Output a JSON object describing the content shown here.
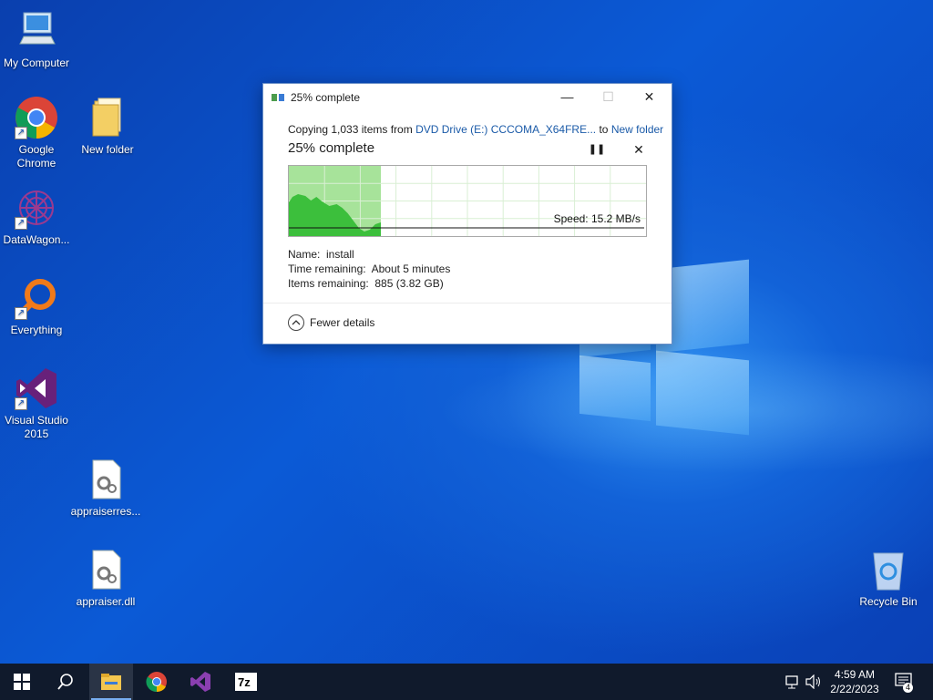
{
  "desktop": {
    "icons": [
      {
        "label": "My Computer",
        "icon": "computer-icon"
      },
      {
        "label": "Google Chrome",
        "icon": "chrome-icon"
      },
      {
        "label": "New folder",
        "icon": "folder-icon"
      },
      {
        "label": "DataWagon...",
        "icon": "datawagon-icon"
      },
      {
        "label": "Everything",
        "icon": "everything-icon"
      },
      {
        "label": "Visual Studio 2015",
        "icon": "visual-studio-icon"
      },
      {
        "label": "appraiserres...",
        "icon": "config-file-icon"
      },
      {
        "label": "appraiser.dll",
        "icon": "dll-file-icon"
      },
      {
        "label": "Recycle Bin",
        "icon": "recycle-bin-icon"
      }
    ]
  },
  "dialog": {
    "title": "25% complete",
    "copy_prefix": "Copying 1,033 items from",
    "source": "DVD Drive (E:) CCCOMA_X64FRE...",
    "to_word": "to",
    "destination": "New folder",
    "progress_text": "25% complete",
    "progress_fraction": 0.25,
    "speed": "Speed: 15.2 MB/s",
    "name_label": "Name:",
    "name_value": "install",
    "time_label": "Time remaining:",
    "time_value": "About 5 minutes",
    "items_label": "Items remaining:",
    "items_value": "885 (3.82 GB)",
    "details_toggle": "Fewer details",
    "colors": {
      "graph_fill": "#3cbf3c",
      "graph_done_bg": "#a7e39a",
      "grid": "#d9efd4"
    }
  },
  "taskbar": {
    "items": [
      "start-icon",
      "search-icon",
      "file-explorer-icon",
      "chrome-icon",
      "visual-studio-icon",
      "7zip-icon"
    ],
    "clock_time": "4:59 AM",
    "clock_date": "2/22/2023",
    "notification_count": "4"
  }
}
